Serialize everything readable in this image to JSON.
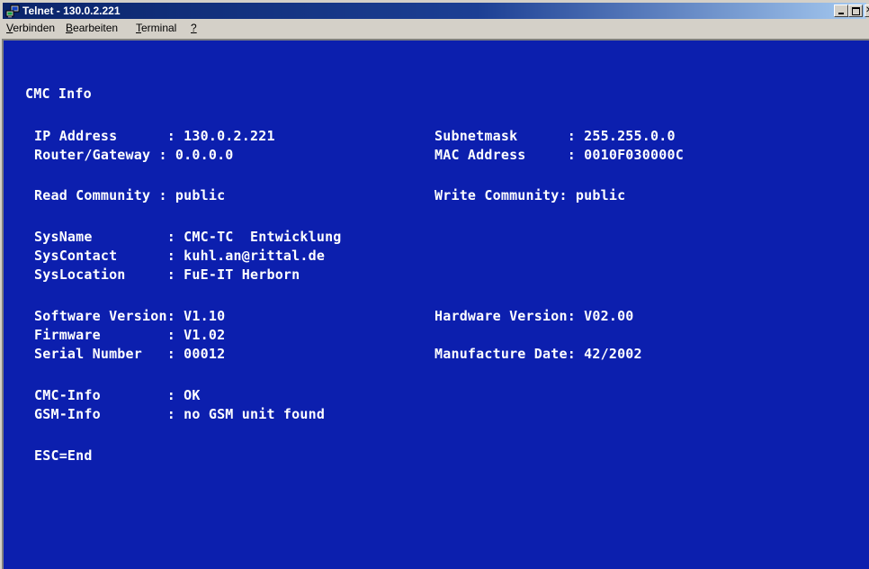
{
  "window": {
    "title": "Telnet - 130.0.2.221",
    "icon": "telnet-app-icon"
  },
  "menu": {
    "items": [
      {
        "accel": "V",
        "rest": "erbinden"
      },
      {
        "accel": "B",
        "rest": "earbeiten"
      },
      {
        "accel": "T",
        "rest": "erminal"
      },
      {
        "accel": "?",
        "rest": ""
      }
    ]
  },
  "terminal": {
    "heading": "CMC Info",
    "ip_address": "IP Address      : 130.0.2.221",
    "subnetmask": "Subnetmask      : 255.255.0.0",
    "router_gateway": "Router/Gateway : 0.0.0.0",
    "mac_address": "MAC Address     : 0010F030000C",
    "read_community": "Read Community : public",
    "write_community": "Write Community: public",
    "sysname": "SysName         : CMC-TC  Entwicklung",
    "syscontact": "SysContact      : kuhl.an@rittal.de",
    "syslocation": "SysLocation     : FuE-IT Herborn",
    "software_version": "Software Version: V1.10",
    "hardware_version": "Hardware Version: V02.00",
    "firmware": "Firmware        : V1.02",
    "serial_number": "Serial Number   : 00012",
    "manufacture_date": "Manufacture Date: 42/2002",
    "cmc_info": "CMC-Info        : OK",
    "gsm_info": "GSM-Info        : no GSM unit found",
    "esc_hint": "ESC=End"
  },
  "colors": {
    "terminal_background": "#0c1fae",
    "terminal_text": "#ffffff",
    "titlebar": "#0a246a"
  }
}
